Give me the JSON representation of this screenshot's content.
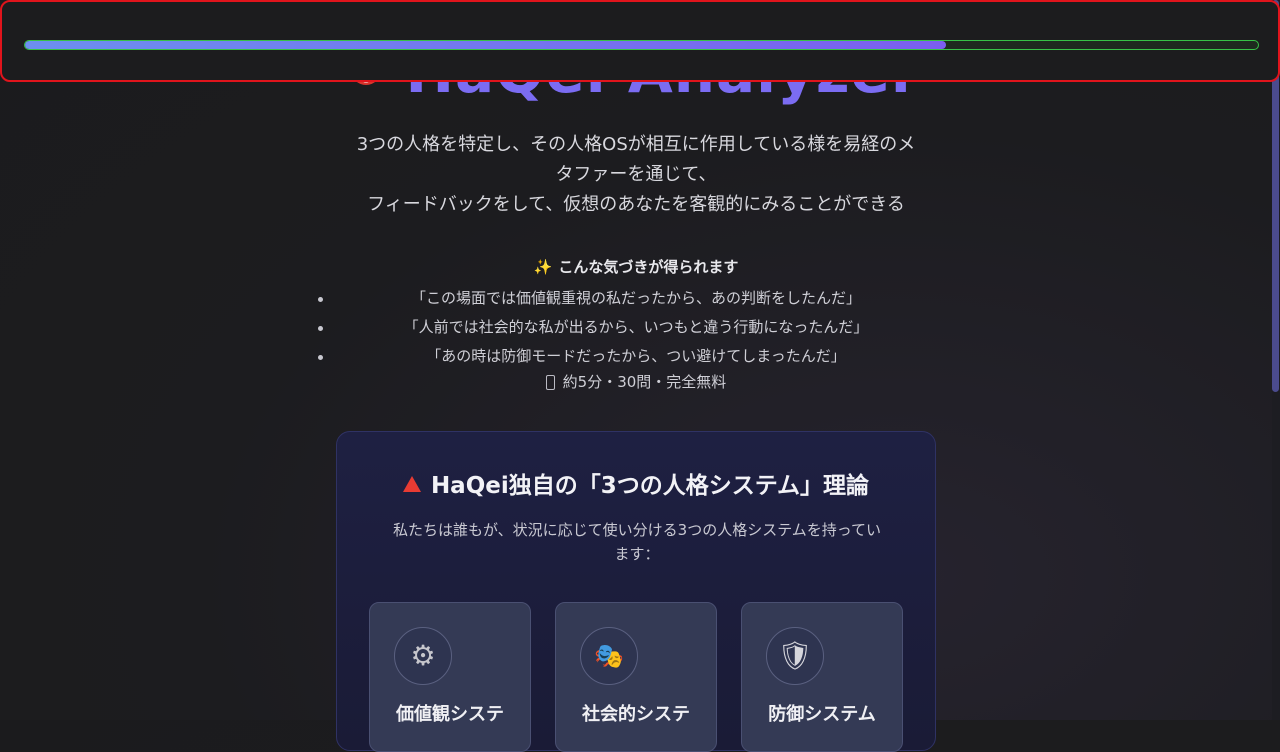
{
  "progress": {
    "fraction": 0.747
  },
  "hero": {
    "title": "HaQei Analyzer",
    "title_icon": "target-icon"
  },
  "tagline": {
    "line1": "3つの人格を特定し、その人格OSが相互に作用している様を易経のメ",
    "line2": "タファーを通じて、",
    "line3": "フィードバックをして、仮想のあなたを客観的にみることができる"
  },
  "insights": {
    "heading": "こんな気づきが得られます",
    "heading_icon": "sparkles-icon",
    "items": [
      "「この場面では価値観重視の私だったから、あの判断をしたんだ」",
      "「人前では社会的な私が出るから、いつもと違う行動になったんだ」",
      "「あの時は防御モードだったから、つい避けてしまったんだ」"
    ],
    "meta": "約5分・30問・完全無料",
    "meta_icon": "phone-icon"
  },
  "theory": {
    "title": "HaQei独自の「3つの人格システム」理論",
    "title_icon": "red-triangle-icon",
    "description_line1": "私たちは誰もが、状況に応じて使い分ける3つの人格システムを持ってい",
    "description_line2": "ます：",
    "systems": [
      {
        "label": "価値観システ",
        "icon": "gear-icon"
      },
      {
        "label": "社会的システ",
        "icon": "theater-masks-icon"
      },
      {
        "label": "防御システム",
        "icon": "shield-icon"
      }
    ]
  },
  "colors": {
    "accent": "#7b6cf2",
    "progress_border": "#37c247",
    "panel_border": "#e0141c",
    "card_bg": "#1e2042"
  }
}
